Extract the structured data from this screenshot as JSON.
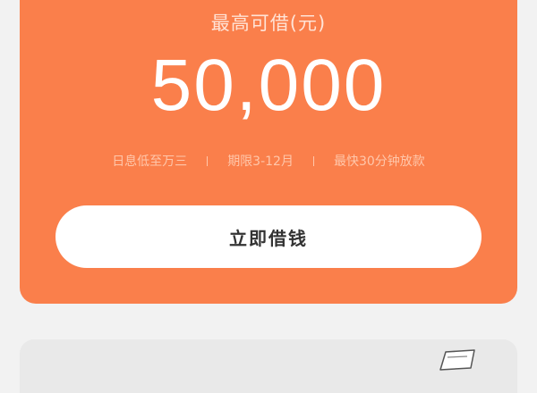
{
  "loan": {
    "title": "最高可借(元)",
    "amount": "50,000",
    "features": [
      "日息低至万三",
      "期限3-12月",
      "最快30分钟放款"
    ],
    "button_label": "立即借钱"
  },
  "colors": {
    "card_background": "#fa7f4b",
    "button_background": "#ffffff",
    "page_background": "#f2f2f2"
  },
  "icons": {
    "next_card_icon": "paper-note-icon"
  }
}
